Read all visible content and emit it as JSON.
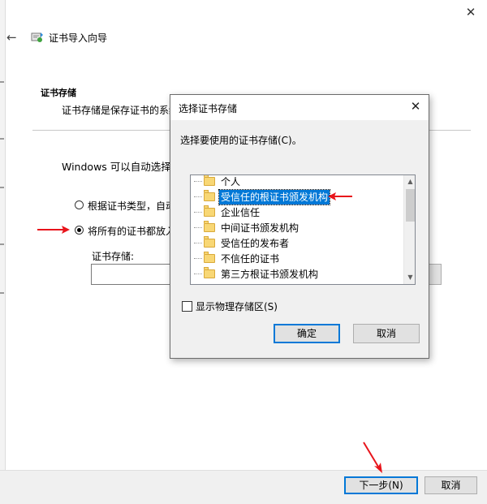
{
  "wizard": {
    "title": "证书导入向导",
    "section_title": "证书存储",
    "section_desc": "证书存储是保存证书的系统",
    "auto_text": "Windows 可以自动选择证",
    "radio_auto_label": "根据证书类型，自动",
    "radio_place_label": "将所有的证书都放入",
    "store_label": "证书存储:",
    "store_value": "",
    "next_button": "下一步(N)",
    "cancel_button": "取消"
  },
  "dialog": {
    "title": "选择证书存储",
    "prompt": "选择要使用的证书存储(C)。",
    "stores": [
      {
        "label": "个人",
        "selected": false
      },
      {
        "label": "受信任的根证书颁发机构",
        "selected": true
      },
      {
        "label": "企业信任",
        "selected": false
      },
      {
        "label": "中间证书颁发机构",
        "selected": false
      },
      {
        "label": "受信任的发布者",
        "selected": false
      },
      {
        "label": "不信任的证书",
        "selected": false
      },
      {
        "label": "第三方根证书颁发机构",
        "selected": false
      }
    ],
    "show_physical_label": "显示物理存储区(S)",
    "show_physical_checked": false,
    "ok_button": "确定",
    "cancel_button": "取消"
  },
  "icons": {
    "close": "close-icon",
    "back": "back-arrow-icon",
    "wizard": "certificate-icon",
    "folder": "folder-icon",
    "annotation": "red-arrow-icon"
  },
  "colors": {
    "accent": "#0078d7",
    "annotation": "#e8141b",
    "folder": "#f8d775",
    "dialog_body": "#f0f0f0"
  }
}
